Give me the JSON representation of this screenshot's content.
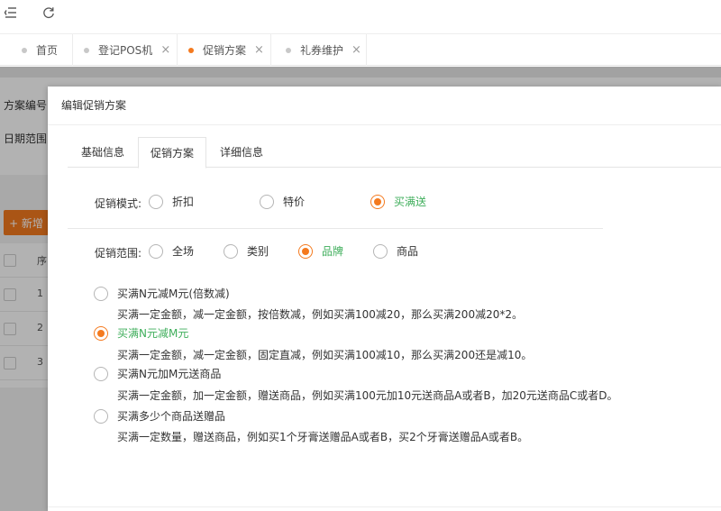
{
  "toolbar": {
    "menu_icon": "menu-fold-icon",
    "refresh_icon": "refresh-icon"
  },
  "tabs": [
    {
      "label": "首页",
      "closable": false,
      "active": false
    },
    {
      "label": "登记POS机",
      "closable": true,
      "active": false
    },
    {
      "label": "促销方案",
      "closable": true,
      "active": true
    },
    {
      "label": "礼券维护",
      "closable": true,
      "active": false
    }
  ],
  "tab_close_glyph": "×",
  "background": {
    "scheme_no_label": "方案编号",
    "date_range_label": "日期范围",
    "add_button": "+ 新增",
    "col_seq": "序",
    "rows": [
      "1",
      "2",
      "3"
    ]
  },
  "modal": {
    "title": "编辑促销方案",
    "tabs": [
      "基础信息",
      "促销方案",
      "详细信息"
    ],
    "active_tab": "促销方案",
    "mode": {
      "label": "促销模式:",
      "options": [
        "折扣",
        "特价",
        "买满送"
      ],
      "selected": "买满送"
    },
    "scope": {
      "label": "促销范围:",
      "options": [
        "全场",
        "类别",
        "品牌",
        "商品"
      ],
      "selected": "品牌"
    },
    "rules": [
      {
        "title": "买满N元减M元(倍数减)",
        "desc": "买满一定金额，减一定金额，按倍数减，例如买满100减20，那么买满200减20*2。",
        "selected": false
      },
      {
        "title": "买满N元减M元",
        "desc": "买满一定金额，减一定金额，固定直减，例如买满100减10，那么买满200还是减10。",
        "selected": true
      },
      {
        "title": "买满N元加M元送商品",
        "desc": "买满一定金额，加一定金额，赠送商品，例如买满100元加10元送商品A或者B，加20元送商品C或者D。",
        "selected": false
      },
      {
        "title": "买满多少个商品送赠品",
        "desc": "买满一定数量，赠送商品，例如买1个牙膏送赠品A或者B，买2个牙膏送赠品A或者B。",
        "selected": false
      }
    ]
  },
  "colors": {
    "accent": "#f47a1f",
    "selected_text": "#3fae5b"
  }
}
